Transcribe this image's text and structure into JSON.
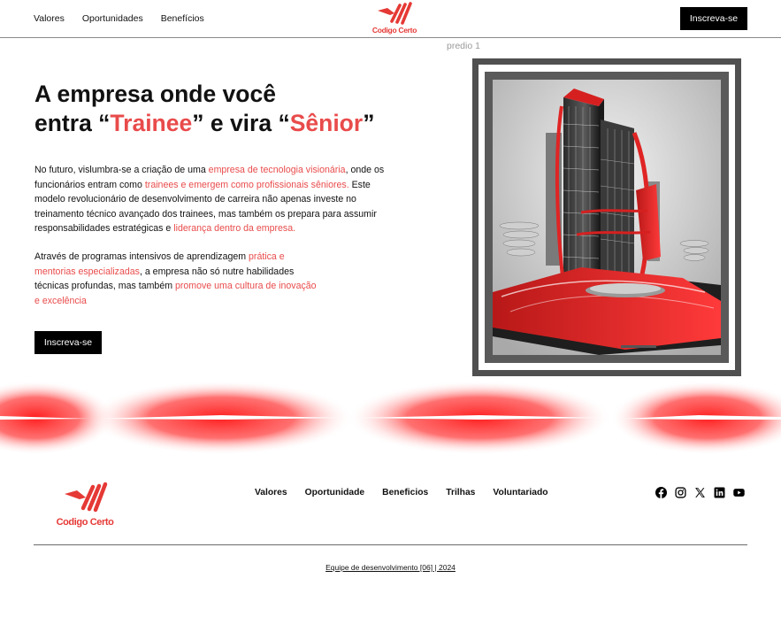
{
  "header": {
    "nav": [
      "Valores",
      "Oportunidades",
      "Benefícios"
    ],
    "logo_text": "Codigo Certo",
    "cta_label": "Inscreva-se"
  },
  "hero": {
    "image_caption": "predio 1",
    "title_line1": "A empresa onde você",
    "title_line2_a": "entra “",
    "title_accent1": "Trainee",
    "title_line2_b": "” e vira “",
    "title_accent2": "Sênior",
    "title_line2_c": "”",
    "paragraph1": [
      {
        "text": "No futuro, vislumbra-se a criação de uma ",
        "accent": false
      },
      {
        "text": "empresa de tecnologia visionária",
        "accent": true
      },
      {
        "text": ", onde os funcionários entram como ",
        "accent": false
      },
      {
        "text": "trainees e emergem como profissionais sêniores.",
        "accent": true
      },
      {
        "text": " Este modelo revolucionário de desenvolvimento de carreira não apenas investe no treinamento técnico avançado dos trainees, mas também os prepara para assumir responsabilidades estratégicas e ",
        "accent": false
      },
      {
        "text": "liderança dentro da empresa.",
        "accent": true
      }
    ],
    "paragraph2": [
      {
        "text": "Através de programas intensivos de aprendizagem ",
        "accent": false
      },
      {
        "text": "prática e mentorias especializadas",
        "accent": true
      },
      {
        "text": ", a empresa não só nutre habilidades técnicas profundas, mas também ",
        "accent": false
      },
      {
        "text": "promove uma cultura de inovação e excelência",
        "accent": true
      }
    ],
    "cta_label": "Inscreva-se"
  },
  "footer": {
    "logo_text": "Codigo Certo",
    "nav": [
      "Valores",
      "Oportunidade",
      "Beneficios",
      "Trilhas",
      "Voluntariado"
    ],
    "socials": [
      "facebook-icon",
      "instagram-icon",
      "x-icon",
      "linkedin-icon",
      "youtube-icon"
    ],
    "credit": "Equipe de desenvolvimento [06] | 2024"
  },
  "colors": {
    "accent": "#e94b4b",
    "brand_red": "#e53935",
    "button_bg": "#000000",
    "frame": "#505050"
  }
}
